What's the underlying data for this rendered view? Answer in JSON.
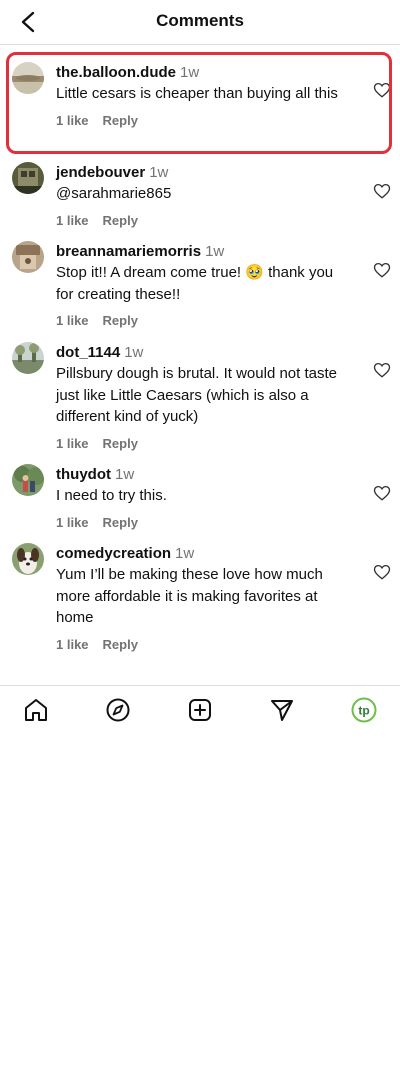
{
  "header": {
    "title": "Comments",
    "back_icon": "chevron-left-icon"
  },
  "comments": [
    {
      "username": "the.balloon.dude",
      "time": "1w",
      "text": "Little cesars is cheaper than buying all this",
      "likes": "1 like",
      "reply": "Reply",
      "highlighted": true
    },
    {
      "username": "jendebouver",
      "time": "1w",
      "text": "@sarahmarie865",
      "likes": "1 like",
      "reply": "Reply"
    },
    {
      "username": "breannamariemorris",
      "time": "1w",
      "text": "Stop it!! A dream come true! 🥹 thank you for creating these!!",
      "likes": "1 like",
      "reply": "Reply"
    },
    {
      "username": "dot_1144",
      "time": "1w",
      "text": "Pillsbury dough is brutal. It would not taste just like Little Caesars (which is also a different kind of yuck)",
      "likes": "1 like",
      "reply": "Reply"
    },
    {
      "username": "thuydot",
      "time": "1w",
      "text": "I need to try this.",
      "likes": "1 like",
      "reply": "Reply"
    },
    {
      "username": "comedycreation",
      "time": "1w",
      "text": "Yum I’ll be making these love how much more affordable it is making favorites at home",
      "likes": "1 like",
      "reply": "Reply"
    }
  ],
  "nav": {
    "items": [
      "home-icon",
      "explore-icon",
      "create-icon",
      "send-icon",
      "profile-avatar"
    ],
    "profile_initials": "tp",
    "accent": "#6cc04a"
  },
  "colors": {
    "highlight_border": "#e0303c",
    "muted_text": "#737373"
  }
}
